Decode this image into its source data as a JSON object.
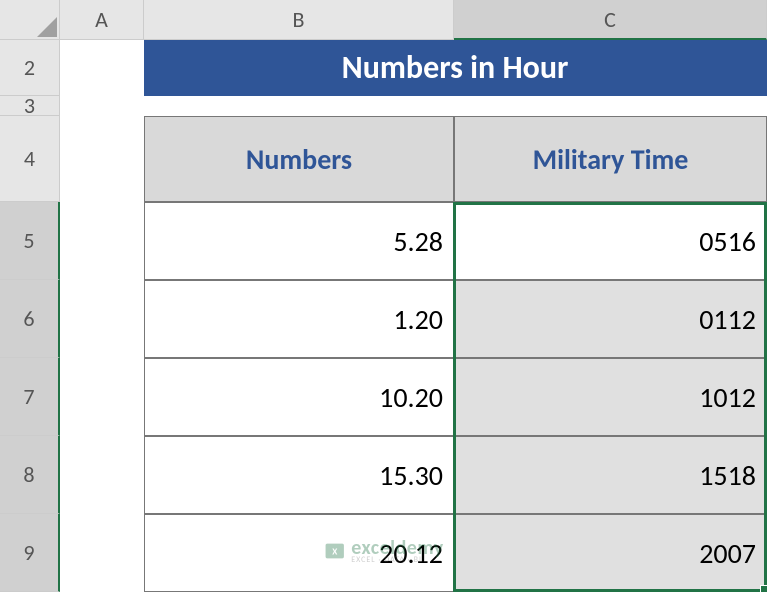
{
  "columns": [
    "A",
    "B",
    "C"
  ],
  "rows": [
    "2",
    "3",
    "4",
    "5",
    "6",
    "7",
    "8",
    "9"
  ],
  "title": "Numbers in Hour",
  "headers": {
    "numbers": "Numbers",
    "military": "Military Time"
  },
  "chart_data": {
    "type": "table",
    "title": "Numbers in Hour",
    "columns": [
      "Numbers",
      "Military Time"
    ],
    "rows": [
      {
        "numbers": "5.28",
        "military": "0516"
      },
      {
        "numbers": "1.20",
        "military": "0112"
      },
      {
        "numbers": "10.20",
        "military": "1012"
      },
      {
        "numbers": "15.30",
        "military": "1518"
      },
      {
        "numbers": "20.12",
        "military": "2007"
      }
    ]
  },
  "watermark": {
    "brand": "exceldemy",
    "sub": "EXCEL · DATA · BI"
  }
}
